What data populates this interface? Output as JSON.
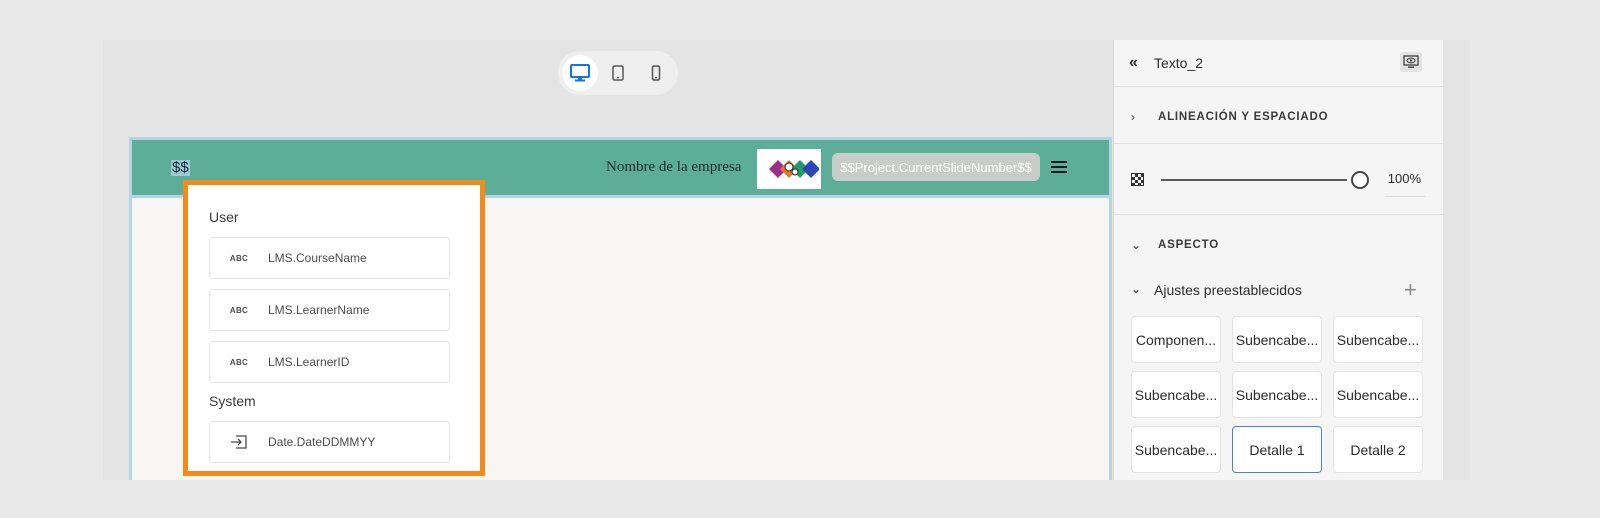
{
  "device_toggle": {
    "items": [
      {
        "name": "desktop",
        "active": true
      },
      {
        "name": "tablet",
        "active": false
      },
      {
        "name": "mobile",
        "active": false
      }
    ]
  },
  "stage": {
    "header": {
      "placeholder_text": "$$",
      "company_name": "Nombre de la empresa",
      "slide_number": "$$Project.CurrentSlideNumber$$"
    }
  },
  "variables_popup": {
    "groups": [
      {
        "label": "User",
        "items": [
          {
            "icon": "ABC",
            "name": "LMS.CourseName"
          },
          {
            "icon": "ABC",
            "name": "LMS.LearnerName"
          },
          {
            "icon": "ABC",
            "name": "LMS.LearnerID"
          }
        ]
      },
      {
        "label": "System",
        "items": [
          {
            "icon": "import-icon",
            "name": "Date.DateDDMMYY"
          }
        ]
      }
    ],
    "accent_color": "#f28b1c"
  },
  "properties": {
    "title": "Texto_2",
    "section_alignment": "ALINEACIÓN Y ESPACIADO",
    "opacity_value": "100%",
    "opacity_fraction": 1.0,
    "section_appearance": "ASPECTO",
    "presets_label": "Ajustes preestablecidos",
    "presets": [
      "Componen...",
      "Subencabe...",
      "Subencabe...",
      "Subencabe...",
      "Subencabe...",
      "Subencabe...",
      "Subencabe...",
      "Detalle 1",
      "Detalle 2"
    ],
    "selected_preset_index": 7
  }
}
